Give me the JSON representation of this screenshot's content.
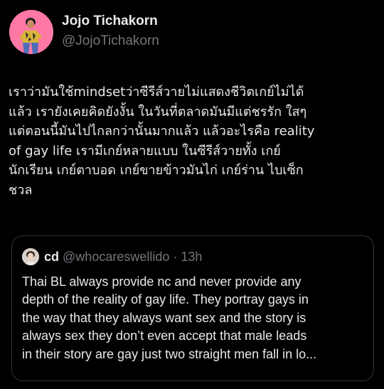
{
  "tweet": {
    "author": {
      "name": "Jojo Tichakorn",
      "handle": "@JojoTichakorn",
      "avatar_bg": "#ff78a6"
    },
    "text_lines": [
      "เราว่ามันใช้mindsetว่าซีรีส์วายไม่แสดงชีวิตเกย์ไม่ได้",
      "แล้ว เรายังเคยคิดยังงั้น ในวันที่ตลาดมันมีแต่ชรรัก ใสๆ",
      "แต่ตอนนี้มันไปไกลกว่านั้นมากแล้ว แล้วอะไรคือ reality",
      "of gay life เรามีเกย์หลายแบบ ในซีรีส์วายทั้ง เกย์",
      "นักเรียน เกย์ตาบอด เกย์ขายข้าวมันไก่ เกย์ร่าน ไบเซ็ก",
      "ชวล"
    ]
  },
  "quoted_tweet": {
    "author_name": "cd",
    "author_handle": "@whocareswellido",
    "separator": "·",
    "time": "13h",
    "text_lines": [
      "Thai BL always provide nc  and never provide any",
      "depth of the reality of gay life. They portray gays in",
      "the way that they always want sex and the story is",
      "always sex they don’t even accept that male leads",
      "in their story are gay just two straight men fall in lo..."
    ]
  },
  "colors": {
    "background": "#000000",
    "text_primary": "#e7e9ea",
    "text_secondary": "#71767b",
    "border": "#2f3336"
  }
}
